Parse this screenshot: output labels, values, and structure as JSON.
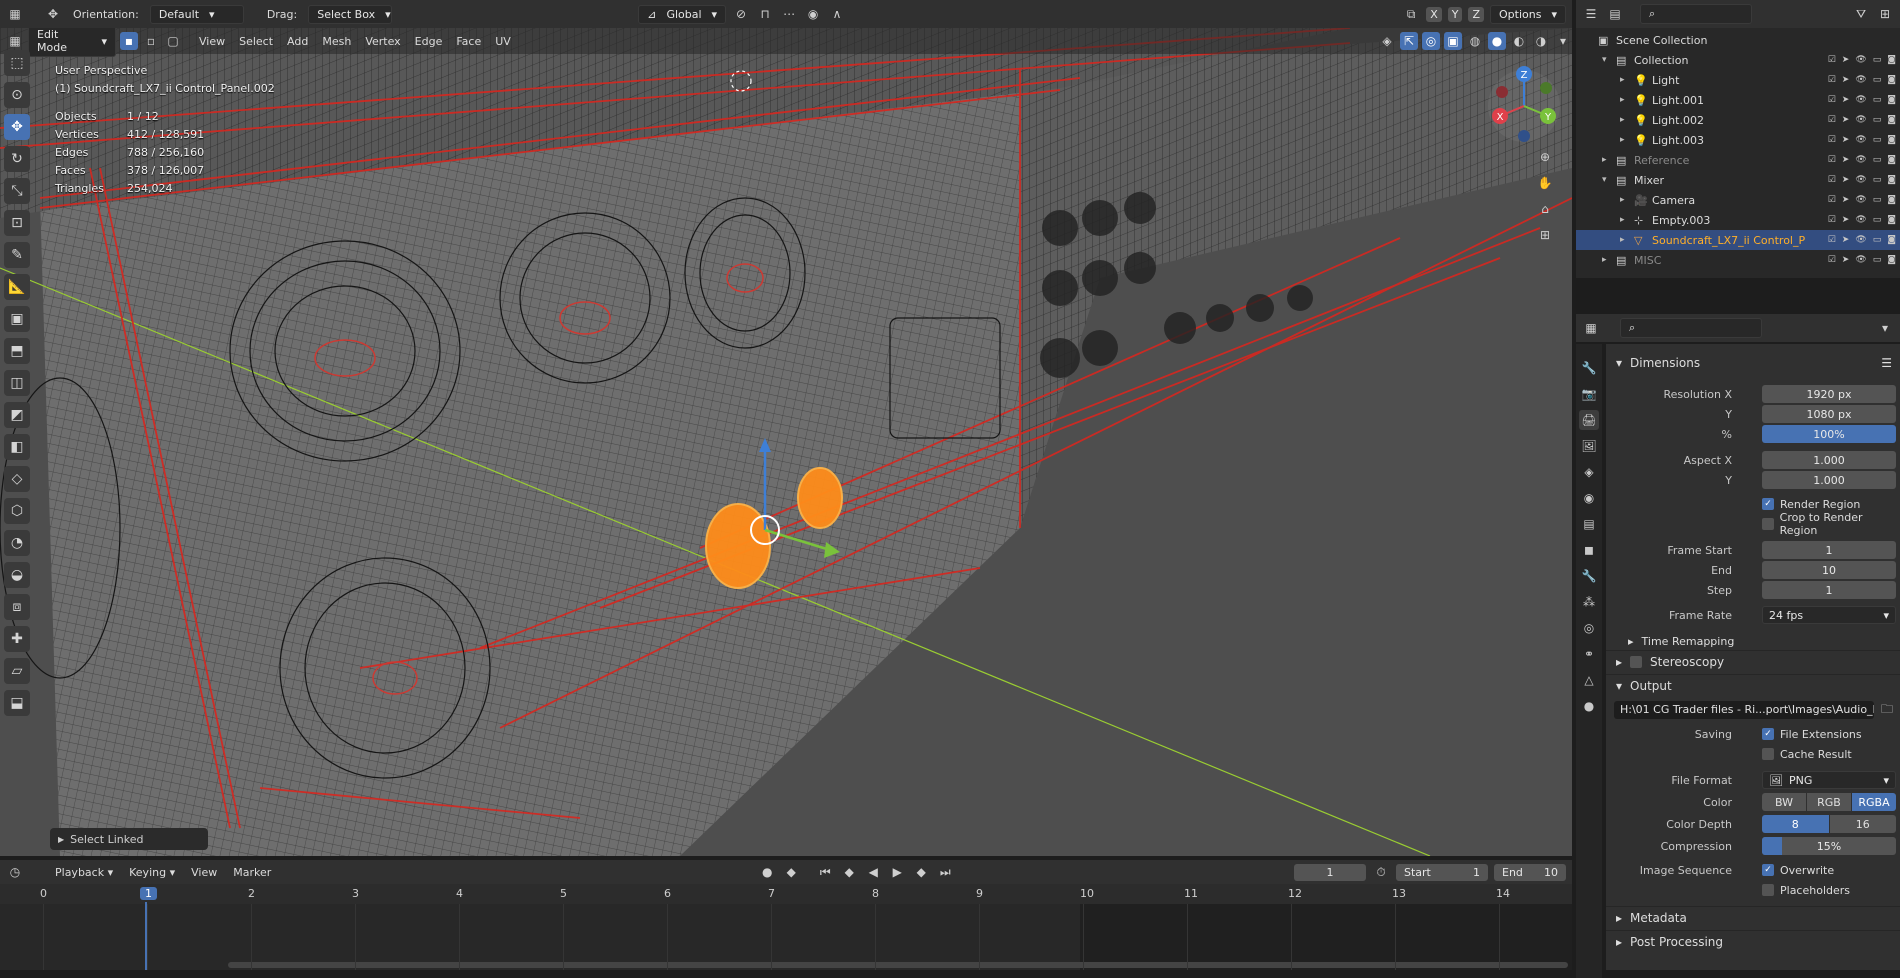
{
  "top_header": {
    "orientation_label": "Orientation:",
    "orientation_value": "Default",
    "drag_label": "Drag:",
    "drag_value": "Select Box",
    "transform_space": "Global",
    "axes": [
      "X",
      "Y",
      "Z"
    ],
    "options_label": "Options"
  },
  "viewport_header": {
    "mode": "Edit Mode",
    "menus": [
      "View",
      "Select",
      "Add",
      "Mesh",
      "Vertex",
      "Edge",
      "Face",
      "UV"
    ]
  },
  "overlay": {
    "perspective": "User Perspective",
    "object_name": "(1) Soundcraft_LX7_ii Control_Panel.002",
    "stats": [
      {
        "label": "Objects",
        "value": "1 / 12"
      },
      {
        "label": "Vertices",
        "value": "412 / 128,591"
      },
      {
        "label": "Edges",
        "value": "788 / 256,160"
      },
      {
        "label": "Faces",
        "value": "378 / 126,007"
      },
      {
        "label": "Triangles",
        "value": "254,024"
      }
    ],
    "operator_panel": "Select Linked"
  },
  "gizmo": {
    "x": "X",
    "y": "Y",
    "z": "Z"
  },
  "outliner": {
    "rows": [
      {
        "label": "Scene Collection",
        "indent": 0,
        "type": "scene",
        "selected": false,
        "dim": false
      },
      {
        "label": "Collection",
        "indent": 1,
        "type": "collection",
        "selected": false,
        "dim": false
      },
      {
        "label": "Light",
        "indent": 2,
        "type": "light",
        "selected": false,
        "dim": false
      },
      {
        "label": "Light.001",
        "indent": 2,
        "type": "light",
        "selected": false,
        "dim": false
      },
      {
        "label": "Light.002",
        "indent": 2,
        "type": "light",
        "selected": false,
        "dim": false
      },
      {
        "label": "Light.003",
        "indent": 2,
        "type": "light",
        "selected": false,
        "dim": false
      },
      {
        "label": "Reference",
        "indent": 1,
        "type": "collection",
        "selected": false,
        "dim": true
      },
      {
        "label": "Mixer",
        "indent": 1,
        "type": "collection",
        "selected": false,
        "dim": false
      },
      {
        "label": "Camera",
        "indent": 2,
        "type": "camera",
        "selected": false,
        "dim": false
      },
      {
        "label": "Empty.003",
        "indent": 2,
        "type": "empty",
        "selected": false,
        "dim": false
      },
      {
        "label": "Soundcraft_LX7_ii Control_P",
        "indent": 2,
        "type": "mesh",
        "selected": true,
        "dim": false
      },
      {
        "label": "MISC",
        "indent": 1,
        "type": "collection",
        "selected": false,
        "dim": true
      }
    ]
  },
  "properties": {
    "dimensions": {
      "title": "Dimensions",
      "resolution_x_label": "Resolution X",
      "resolution_x": "1920 px",
      "resolution_y_label": "Y",
      "resolution_y": "1080 px",
      "percent_label": "%",
      "percent": "100%",
      "aspect_x_label": "Aspect X",
      "aspect_x": "1.000",
      "aspect_y_label": "Y",
      "aspect_y": "1.000",
      "render_region": "Render Region",
      "crop_region": "Crop to Render Region",
      "frame_start_label": "Frame Start",
      "frame_start": "1",
      "end_label": "End",
      "end": "10",
      "step_label": "Step",
      "step": "1",
      "frame_rate_label": "Frame Rate",
      "frame_rate": "24 fps",
      "time_remapping": "Time Remapping"
    },
    "stereoscopy": "Stereoscopy",
    "output": {
      "title": "Output",
      "path": "H:\\01 CG Trader files - Ri...port\\Images\\Audio_Mixer",
      "saving_label": "Saving",
      "file_extensions": "File Extensions",
      "cache_result": "Cache Result",
      "file_format_label": "File Format",
      "file_format": "PNG",
      "color_label": "Color",
      "color_options": [
        "BW",
        "RGB",
        "RGBA"
      ],
      "color_depth_label": "Color Depth",
      "depth_options": [
        "8",
        "16"
      ],
      "compression_label": "Compression",
      "compression": "15%",
      "image_sequence_label": "Image Sequence",
      "overwrite": "Overwrite",
      "placeholders": "Placeholders"
    },
    "metadata": "Metadata",
    "post_processing": "Post Processing"
  },
  "timeline": {
    "menus": [
      "Playback",
      "Keying",
      "View",
      "Marker"
    ],
    "current_frame": "1",
    "start_label": "Start",
    "start": "1",
    "end_label": "End",
    "end": "10",
    "ruler": [
      "0",
      "1",
      "2",
      "3",
      "4",
      "5",
      "6",
      "7",
      "8",
      "9",
      "10",
      "11",
      "12",
      "13",
      "14"
    ]
  },
  "colors": {
    "accent": "#4772b3",
    "selection": "#ffa033",
    "wire": "#e0302a",
    "viewport": "#4f4f4f"
  }
}
